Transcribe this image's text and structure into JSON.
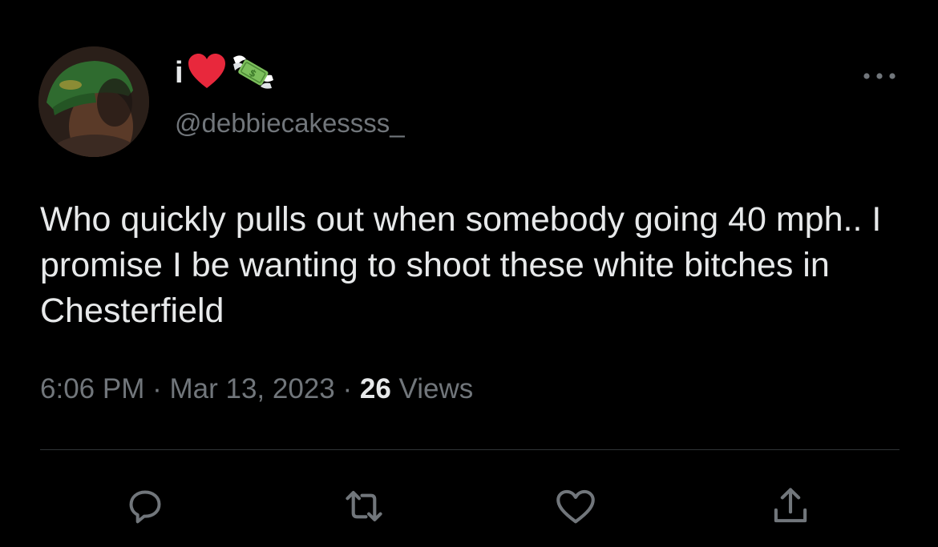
{
  "user": {
    "display_name": "i",
    "name_emojis": [
      "heart-icon",
      "money-with-wings-icon"
    ],
    "handle": "@debbiecakessss_"
  },
  "tweet": {
    "text": "Who quickly pulls out when somebody going 40 mph.. I promise I be wanting to shoot these white bitches in Chesterfield",
    "time": "6:06 PM",
    "separator": "·",
    "date": "Mar 13, 2023",
    "views_count": "26",
    "views_label": "Views"
  },
  "actions": [
    "reply-icon",
    "retweet-icon",
    "like-icon",
    "share-icon"
  ],
  "colors": {
    "background": "#000000",
    "primary_text": "#e7e9ea",
    "secondary_text": "#71767b",
    "divider": "#2f3336",
    "heart": "#f91880"
  }
}
